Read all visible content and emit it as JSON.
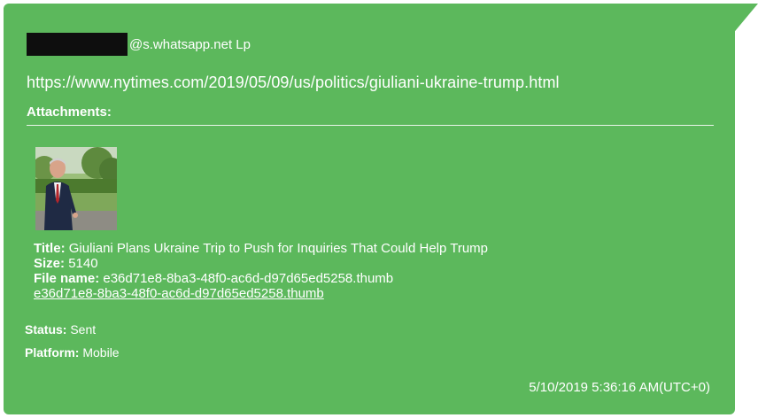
{
  "message": {
    "sender_suffix": "@s.whatsapp.net Lp",
    "url": "https://www.nytimes.com/2019/05/09/us/politics/giuliani-ukraine-trump.html",
    "attachments_label": "Attachments:",
    "attachment": {
      "title_label": "Title:",
      "title": "Giuliani Plans Ukraine Trip to Push for Inquiries That Could Help Trump",
      "size_label": "Size:",
      "size": "5140",
      "file_name_label": "File name:",
      "file_name": "e36d71e8-8ba3-48f0-ac6d-d97d65ed5258.thumb",
      "file_link": "e36d71e8-8ba3-48f0-ac6d-d97d65ed5258.thumb"
    },
    "status_label": "Status:",
    "status": "Sent",
    "platform_label": "Platform:",
    "platform": "Mobile",
    "timestamp": "5/10/2019 5:36:16 AM(UTC+0)"
  },
  "colors": {
    "bubble": "#5cb85c",
    "redaction": "#0e0e0e",
    "text": "#ffffff"
  }
}
